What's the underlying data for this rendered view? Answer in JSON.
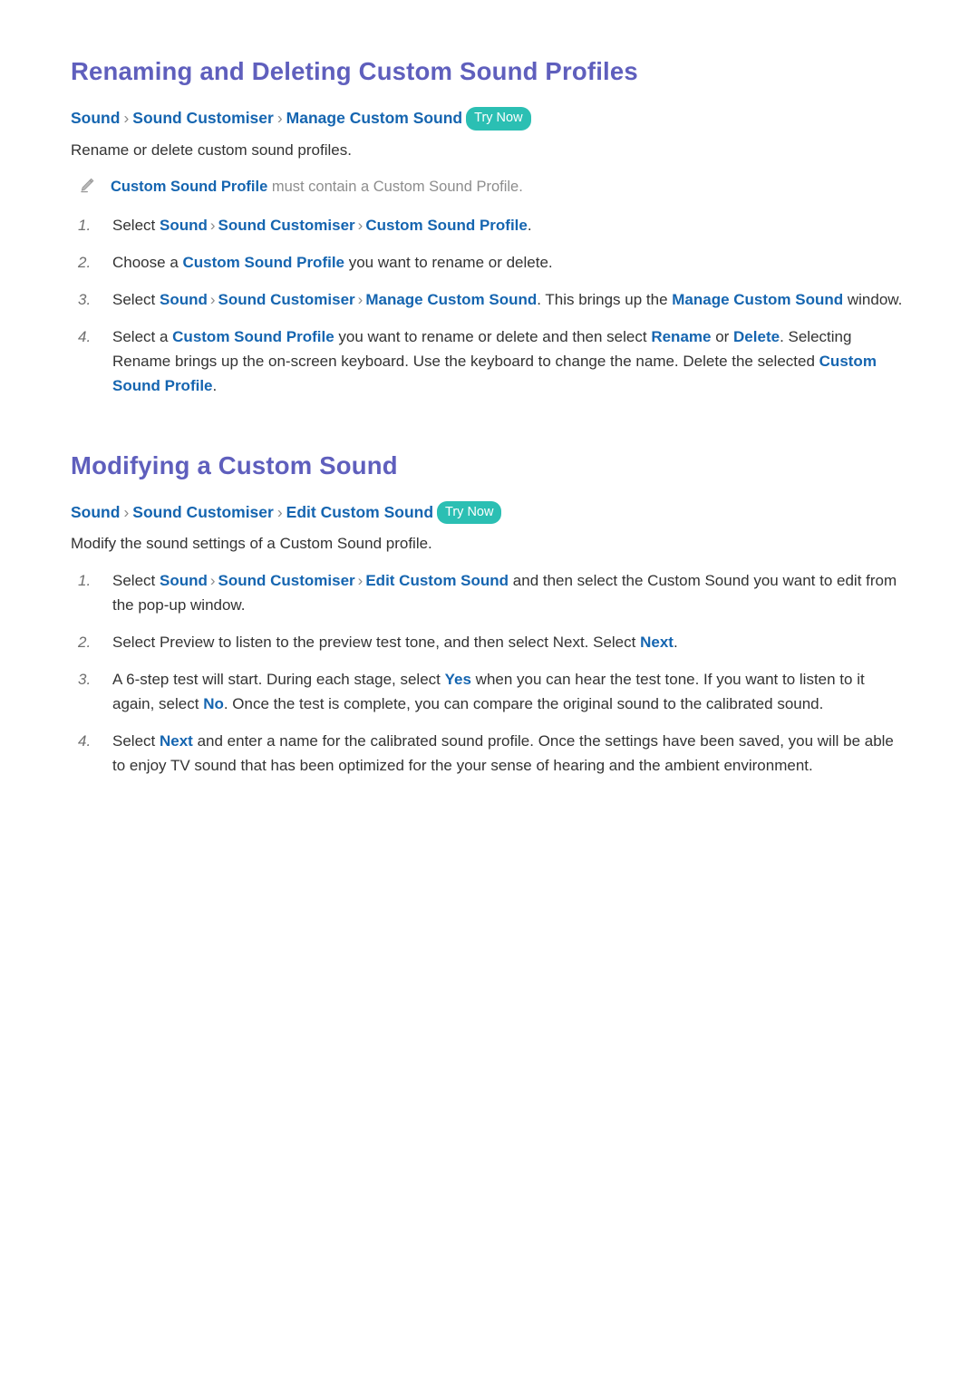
{
  "document": {
    "sections": [
      {
        "id": "renaming-deleting",
        "title": "Renaming and Deleting Custom Sound Profiles",
        "breadcrumb": {
          "crumbs": [
            "Sound",
            "Sound Customiser",
            "Manage Custom Sound"
          ],
          "separator": "›",
          "badge": "Try Now"
        },
        "intro": "Rename or delete custom sound profiles.",
        "note": {
          "icon": "pencil-icon",
          "term": "Custom Sound Profile",
          "rest": " must contain a Custom Sound Profile."
        },
        "steps": [
          {
            "marker": "1.",
            "parts": [
              {
                "t": "Select ",
                "s": "plain"
              },
              {
                "t": "Sound",
                "s": "term"
              },
              {
                "t": "›",
                "s": "sep"
              },
              {
                "t": "Sound Customiser",
                "s": "term"
              },
              {
                "t": "›",
                "s": "sep"
              },
              {
                "t": "Custom Sound Profile",
                "s": "term"
              },
              {
                "t": ".",
                "s": "plain"
              }
            ]
          },
          {
            "marker": "2.",
            "parts": [
              {
                "t": "Choose a ",
                "s": "plain"
              },
              {
                "t": "Custom Sound Profile",
                "s": "term"
              },
              {
                "t": " you want to rename or delete.",
                "s": "plain"
              }
            ]
          },
          {
            "marker": "3.",
            "parts": [
              {
                "t": "Select ",
                "s": "plain"
              },
              {
                "t": "Sound",
                "s": "term"
              },
              {
                "t": "›",
                "s": "sep"
              },
              {
                "t": "Sound Customiser",
                "s": "term"
              },
              {
                "t": "›",
                "s": "sep"
              },
              {
                "t": "Manage Custom Sound",
                "s": "term"
              },
              {
                "t": ". This brings up the ",
                "s": "plain"
              },
              {
                "t": "Manage Custom Sound",
                "s": "term"
              },
              {
                "t": " window.",
                "s": "plain"
              }
            ]
          },
          {
            "marker": "4.",
            "parts": [
              {
                "t": "Select a ",
                "s": "plain"
              },
              {
                "t": "Custom Sound Profile",
                "s": "term"
              },
              {
                "t": " you want to rename or delete and then select ",
                "s": "plain"
              },
              {
                "t": "Rename",
                "s": "term"
              },
              {
                "t": " or ",
                "s": "plain"
              },
              {
                "t": "Delete",
                "s": "term"
              },
              {
                "t": ". Selecting Rename brings up the on-screen keyboard. Use the keyboard to change the name. Delete the selected ",
                "s": "plain"
              },
              {
                "t": "Custom Sound Profile",
                "s": "term"
              },
              {
                "t": ".",
                "s": "plain"
              }
            ]
          }
        ]
      },
      {
        "id": "modifying-custom-sound",
        "title": "Modifying a Custom Sound",
        "breadcrumb": {
          "crumbs": [
            "Sound",
            "Sound Customiser",
            "Edit Custom Sound"
          ],
          "separator": "›",
          "badge": "Try Now"
        },
        "intro": "Modify the sound settings of a Custom Sound profile.",
        "note": null,
        "steps": [
          {
            "marker": "1.",
            "parts": [
              {
                "t": "Select ",
                "s": "plain"
              },
              {
                "t": "Sound",
                "s": "term"
              },
              {
                "t": "›",
                "s": "sep"
              },
              {
                "t": "Sound Customiser",
                "s": "term"
              },
              {
                "t": "›",
                "s": "sep"
              },
              {
                "t": "Edit Custom Sound",
                "s": "term"
              },
              {
                "t": " and then select the Custom Sound you want to edit from the pop-up window.",
                "s": "plain"
              }
            ]
          },
          {
            "marker": "2.",
            "parts": [
              {
                "t": "Select Preview to listen to the preview test tone, and then select Next. Select ",
                "s": "plain"
              },
              {
                "t": "Next",
                "s": "term"
              },
              {
                "t": ".",
                "s": "plain"
              }
            ]
          },
          {
            "marker": "3.",
            "parts": [
              {
                "t": "A 6-step test will start. During each stage, select ",
                "s": "plain"
              },
              {
                "t": "Yes",
                "s": "term"
              },
              {
                "t": " when you can hear the test tone. If you want to listen to it again, select ",
                "s": "plain"
              },
              {
                "t": "No",
                "s": "term"
              },
              {
                "t": ". Once the test is complete, you can compare the original sound to the calibrated sound.",
                "s": "plain"
              }
            ]
          },
          {
            "marker": "4.",
            "parts": [
              {
                "t": "Select ",
                "s": "plain"
              },
              {
                "t": "Next",
                "s": "term"
              },
              {
                "t": " and enter a name for the calibrated sound profile. Once the settings have been saved, you will be able to enjoy TV sound that has been optimized for the your sense of hearing and the ambient environment.",
                "s": "plain"
              }
            ]
          }
        ]
      }
    ],
    "colors": {
      "heading": "#5f5fbd",
      "link": "#1565b0",
      "body": "#333333",
      "note": "#8d8d8d",
      "badge_bg": "#2bbfb3",
      "badge_text": "#ffffff"
    }
  }
}
